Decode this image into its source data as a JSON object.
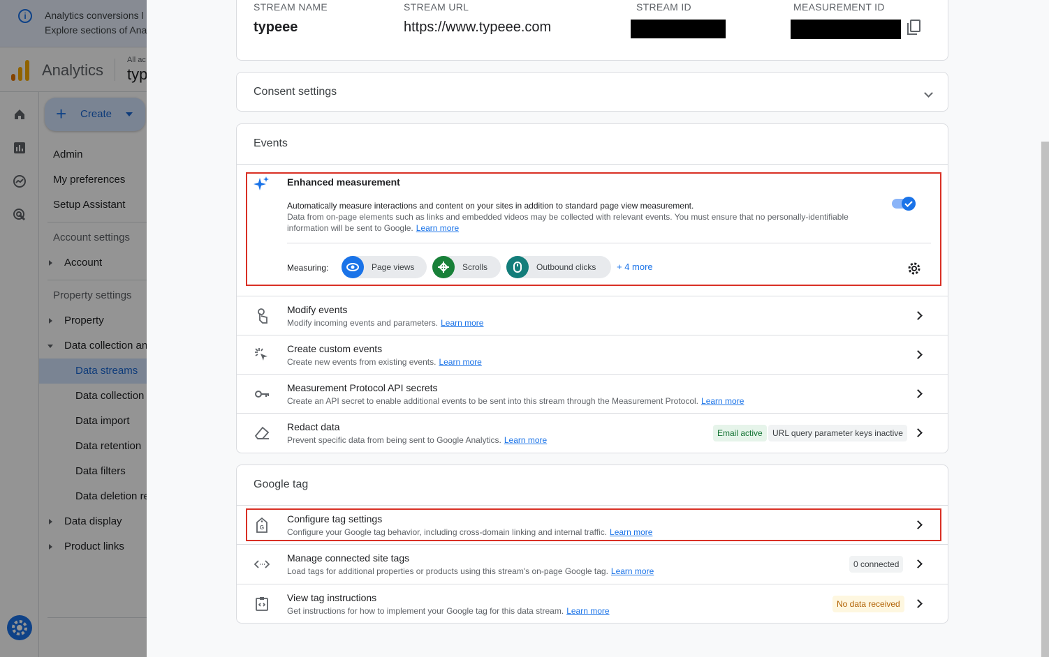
{
  "background_app": {
    "banner": {
      "line1": "Analytics conversions l",
      "line2": "Explore sections of Ana"
    },
    "app_name": "Analytics",
    "account_label": "All ac",
    "property_name": "typ",
    "create_label": "Create",
    "nav": {
      "admin": "Admin",
      "my_preferences": "My preferences",
      "setup_assistant": "Setup Assistant",
      "account_settings": "Account settings",
      "account": "Account",
      "property_settings": "Property settings",
      "property": "Property",
      "data_collection_and": "Data collection an",
      "data_streams": "Data streams",
      "data_collection": "Data collection",
      "data_import": "Data import",
      "data_retention": "Data retention",
      "data_filters": "Data filters",
      "data_deletion": "Data deletion re",
      "data_display": "Data display",
      "product_links": "Product links"
    }
  },
  "stream": {
    "name_header": "STREAM NAME",
    "name_value": "typeee",
    "url_header": "STREAM URL",
    "url_value": "https://www.typeee.com",
    "id_header": "STREAM ID",
    "measurement_header": "MEASUREMENT ID"
  },
  "consent": {
    "title": "Consent settings"
  },
  "events": {
    "title": "Events",
    "enhanced": {
      "title": "Enhanced measurement",
      "desc1": "Automatically measure interactions and content on your sites in addition to standard page view measurement.",
      "desc2": "Data from on-page elements such as links and embedded videos may be collected with relevant events. You must ensure that no personally-identifiable",
      "desc3": "information will be sent to Google.",
      "learn_more": "Learn more",
      "enabled": true,
      "measuring_label": "Measuring:",
      "chips": [
        "Page views",
        "Scrolls",
        "Outbound clicks"
      ],
      "more": "+ 4 more"
    },
    "rows": [
      {
        "title": "Modify events",
        "desc": "Modify incoming events and parameters.",
        "link": "Learn more"
      },
      {
        "title": "Create custom events",
        "desc": "Create new events from existing events.",
        "link": "Learn more"
      },
      {
        "title": "Measurement Protocol API secrets",
        "desc": "Create an API secret to enable additional events to be sent into this stream through the Measurement Protocol.",
        "link": "Learn more"
      },
      {
        "title": "Redact data",
        "desc": "Prevent specific data from being sent to Google Analytics.",
        "link": "Learn more",
        "badges": [
          "Email active",
          "URL query parameter keys inactive"
        ]
      }
    ]
  },
  "google_tag": {
    "title": "Google tag",
    "rows": [
      {
        "title": "Configure tag settings",
        "desc": "Configure your Google tag behavior, including cross-domain linking and internal traffic.",
        "link": "Learn more"
      },
      {
        "title": "Manage connected site tags",
        "desc": "Load tags for additional properties or products using this stream's on-page Google tag.",
        "link": "Learn more",
        "badge": "0 connected"
      },
      {
        "title": "View tag instructions",
        "desc": "Get instructions for how to implement your Google tag for this data stream.",
        "link": "Learn more",
        "badge": "No data received"
      }
    ]
  },
  "colors": {
    "accent": "#1a73e8",
    "highlight_box": "#d93025",
    "warning_badge_bg": "#fef7e0",
    "success_badge_bg": "#e6f4ea"
  }
}
